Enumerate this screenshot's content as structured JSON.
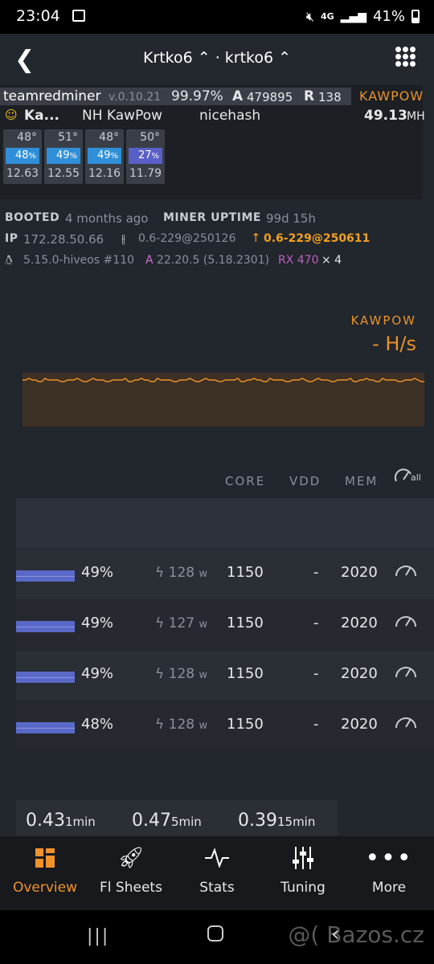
{
  "status_bar": {
    "time": "23:04",
    "network": "4G",
    "battery": "41%"
  },
  "header": {
    "back_icon": "chevron-left",
    "title": "Krtko6 ⌃ · krtko6 ⌃",
    "menu_icon": "grid-dots"
  },
  "miner": {
    "name": "teamredminer",
    "version": "v.0.10.21",
    "accepted_pct": "99.97%",
    "a_label": "A",
    "accepted": "479895",
    "r_label": "R",
    "rejected": "138",
    "algo": "KAWPOW",
    "wallet": "Ka...",
    "flight_sheet": "NH KawPow",
    "pool": "nicehash",
    "hashrate": "49.13",
    "hashrate_unit": "MH",
    "gpus": [
      {
        "temp": "48°",
        "fan": "48",
        "hash": "12.63",
        "color": "#2f8fd8"
      },
      {
        "temp": "51°",
        "fan": "49",
        "hash": "12.55",
        "color": "#2f8fd8"
      },
      {
        "temp": "48°",
        "fan": "49",
        "hash": "12.16",
        "color": "#2f8fd8"
      },
      {
        "temp": "50°",
        "fan": "27",
        "hash": "11.79",
        "color": "#5a5fc8"
      }
    ]
  },
  "info": {
    "booted_label": "BOOTED",
    "booted": "4 months ago",
    "uptime_label": "MINER UPTIME",
    "uptime": "99d 15h",
    "ip_label": "IP",
    "ip": "172.28.50.66",
    "hive_version": "0.6-229@250126",
    "hive_update": "0.6-229@250611",
    "kernel": "5.15.0-hiveos #110",
    "amd_label": "A",
    "amd_driver": "22.20.5 (5.18.2301)",
    "gpu_model": "RX 470",
    "gpu_count": "× 4"
  },
  "chart": {
    "algo": "KAWPOW",
    "rate": "- H/s",
    "color": "#e8922a"
  },
  "table": {
    "headers": {
      "core": "CORE",
      "vdd": "VDD",
      "mem": "MEM",
      "all": "all"
    },
    "rows": [
      {
        "fan": "49%",
        "power": "128",
        "unit": "w",
        "core": "1150",
        "vdd": "-",
        "mem": "2020"
      },
      {
        "fan": "49%",
        "power": "127",
        "unit": "w",
        "core": "1150",
        "vdd": "-",
        "mem": "2020"
      },
      {
        "fan": "49%",
        "power": "128",
        "unit": "w",
        "core": "1150",
        "vdd": "-",
        "mem": "2020"
      },
      {
        "fan": "48%",
        "power": "128",
        "unit": "w",
        "core": "1150",
        "vdd": "-",
        "mem": "2020"
      }
    ]
  },
  "load": [
    {
      "value": "0.43",
      "unit": "1min"
    },
    {
      "value": "0.47",
      "unit": "5min"
    },
    {
      "value": "0.39",
      "unit": "15min"
    }
  ],
  "nav": [
    {
      "label": "Overview",
      "icon": "overview-icon",
      "active": true
    },
    {
      "label": "Fl Sheets",
      "icon": "rocket-icon"
    },
    {
      "label": "Stats",
      "icon": "pulse-icon"
    },
    {
      "label": "Tuning",
      "icon": "sliders-icon"
    },
    {
      "label": "More",
      "icon": "more-icon"
    }
  ],
  "watermark": "@( Bazos.cz"
}
